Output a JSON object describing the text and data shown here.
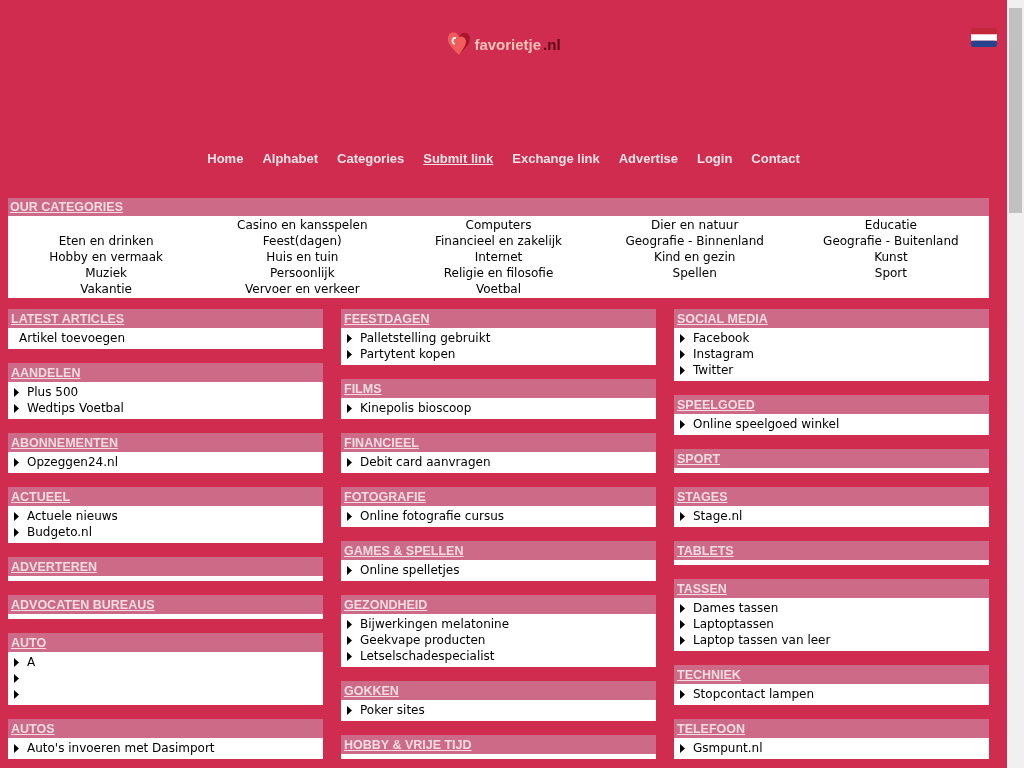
{
  "logo": {
    "name": "favorietje",
    "tld": ".nl"
  },
  "nav": [
    {
      "label": "Home",
      "selected": false
    },
    {
      "label": "Alphabet",
      "selected": false
    },
    {
      "label": "Categories",
      "selected": false
    },
    {
      "label": "Submit link",
      "selected": true
    },
    {
      "label": "Exchange link",
      "selected": false
    },
    {
      "label": "Advertise",
      "selected": false
    },
    {
      "label": "Login",
      "selected": false
    },
    {
      "label": "Contact",
      "selected": false
    }
  ],
  "categories": {
    "title": "OUR CATEGORIES",
    "items": [
      "Casino en kansspelen",
      "Computers",
      "Dier en natuur",
      "Educatie",
      "Eten en drinken",
      "Feest(dagen)",
      "Financieel en zakelijk",
      "Geografie - Binnenland",
      "Geografie - Buitenland",
      "Hobby en vermaak",
      "Huis en tuin",
      "Internet",
      "Kind en gezin",
      "Kunst",
      "Muziek",
      "Persoonlijk",
      "Religie en filosofie",
      "Spellen",
      "Sport",
      "Vakantie",
      "Vervoer en verkeer",
      "Voetbal"
    ]
  },
  "columns": [
    [
      {
        "title": "LATEST ARTICLES",
        "kind": "plain",
        "items": [
          "Artikel toevoegen"
        ]
      },
      {
        "title": "AANDELEN",
        "kind": "bullets",
        "items": [
          "Plus 500",
          "Wedtips Voetbal"
        ]
      },
      {
        "title": "ABONNEMENTEN",
        "kind": "bullets",
        "items": [
          "Opzeggen24.nl"
        ]
      },
      {
        "title": "ACTUEEL",
        "kind": "bullets",
        "items": [
          "Actuele nieuws",
          "Budgeto.nl"
        ]
      },
      {
        "title": "ADVERTEREN",
        "kind": "bullets"
      },
      {
        "title": "ADVOCATEN BUREAUS",
        "kind": "bullets"
      },
      {
        "title": "AUTO",
        "kind": "bullets",
        "items": [
          "A",
          {
            "bullet": true
          },
          {
            "bullet": true
          }
        ]
      },
      {
        "title": "AUTOS",
        "kind": "bullets",
        "items": [
          "Auto's invoeren met Dasimport"
        ]
      }
    ],
    [
      {
        "title": "FEESTDAGEN",
        "kind": "bullets",
        "items": [
          "Palletstelling gebruikt",
          "Partytent kopen"
        ]
      },
      {
        "title": "FILMS",
        "kind": "bullets",
        "items": [
          "Kinepolis bioscoop"
        ]
      },
      {
        "title": "FINANCIEEL",
        "kind": "bullets",
        "items": [
          "Debit card aanvragen"
        ]
      },
      {
        "title": "FOTOGRAFIE",
        "kind": "bullets",
        "items": [
          "Online fotografie cursus"
        ]
      },
      {
        "title": "GAMES & SPELLEN",
        "kind": "bullets",
        "items": [
          "Online spelletjes"
        ]
      },
      {
        "title": "GEZONDHEID",
        "kind": "bullets",
        "items": [
          "Bijwerkingen melatonine",
          "Geekvape producten",
          "Letselschadespecialist"
        ]
      },
      {
        "title": "GOKKEN",
        "kind": "bullets",
        "items": [
          "Poker sites"
        ]
      },
      {
        "title": "HOBBY & VRIJE TIJD",
        "kind": "bullets"
      }
    ],
    [
      {
        "title": "SOCIAL MEDIA",
        "kind": "bullets",
        "items": [
          "Facebook",
          "Instagram",
          "Twitter"
        ]
      },
      {
        "title": "SPEELGOED",
        "kind": "bullets",
        "items": [
          "Online speelgoed winkel"
        ]
      },
      {
        "title": "SPORT",
        "kind": "bullets"
      },
      {
        "title": "STAGES",
        "kind": "bullets",
        "items": [
          "Stage.nl"
        ]
      },
      {
        "title": "TABLETS",
        "kind": "bullets"
      },
      {
        "title": "TASSEN",
        "kind": "bullets",
        "items": [
          "Dames tassen",
          "Laptoptassen",
          "Laptop tassen van leer"
        ]
      },
      {
        "title": "TECHNIEK",
        "kind": "bullets",
        "items": [
          "Stopcontact lampen"
        ]
      },
      {
        "title": "TELEFOON",
        "kind": "bullets",
        "items": [
          "Gsmpunt.nl"
        ]
      }
    ]
  ]
}
